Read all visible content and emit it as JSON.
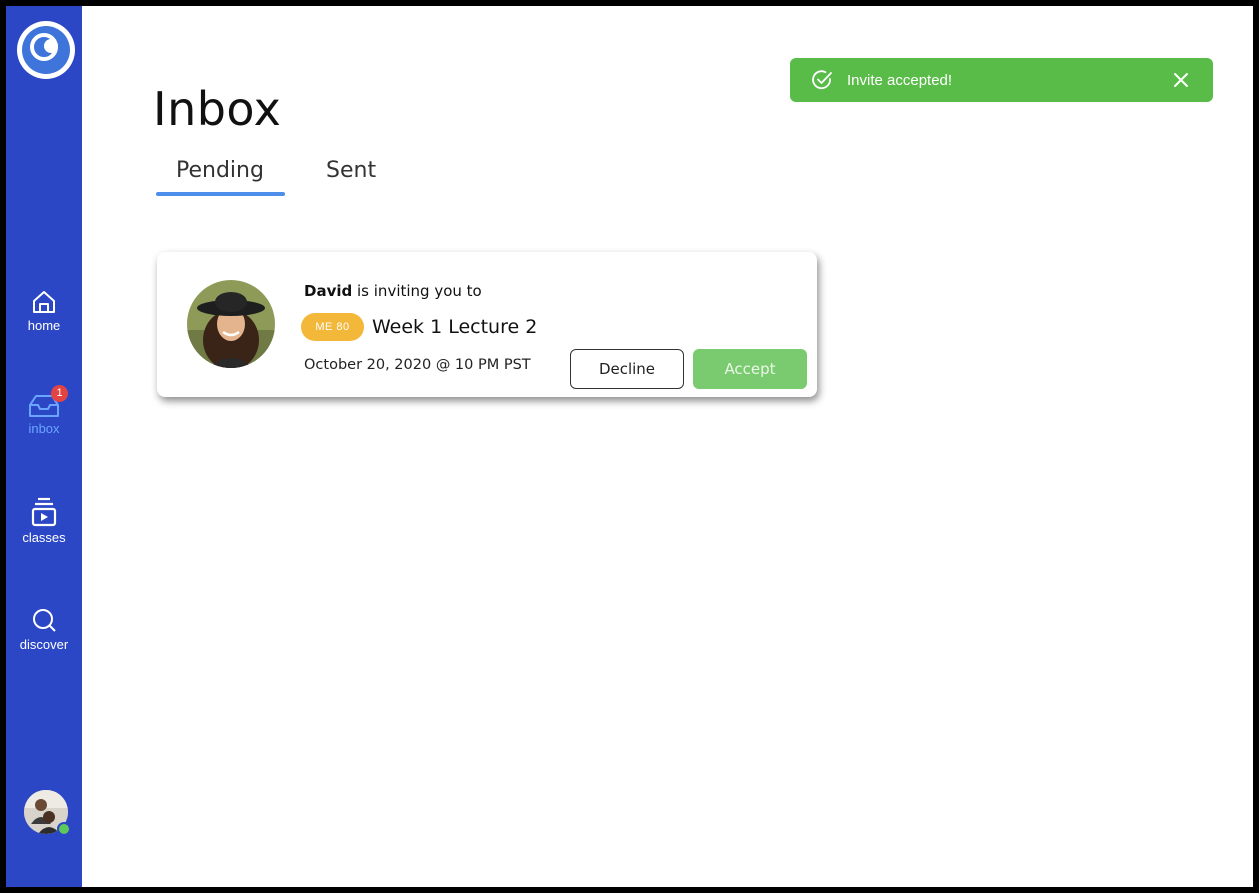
{
  "app": {
    "page_title": "Inbox"
  },
  "sidebar": {
    "items": [
      {
        "label": "home",
        "icon": "home-icon"
      },
      {
        "label": "inbox",
        "icon": "inbox-tray-icon",
        "badge": "1",
        "active": true
      },
      {
        "label": "classes",
        "icon": "classes-stack-icon"
      },
      {
        "label": "discover",
        "icon": "search-icon"
      }
    ],
    "user_status": "online"
  },
  "tabs": [
    {
      "label": "Pending",
      "selected": true
    },
    {
      "label": "Sent",
      "selected": false
    }
  ],
  "toast": {
    "message": "Invite accepted!",
    "color": "#59bb48"
  },
  "invite": {
    "sender": "David",
    "text": "is inviting you to",
    "course_code": "ME 80",
    "event_title": "Week 1 Lecture 2",
    "datetime": "October 20, 2020 @ 10 PM PST",
    "decline_label": "Decline",
    "accept_label": "Accept"
  },
  "colors": {
    "sidebar": "#2b47c6",
    "accent": "#4d8eea",
    "course_chip": "#f3b73a",
    "accept": "#7acb6f",
    "badge": "#e24343"
  }
}
